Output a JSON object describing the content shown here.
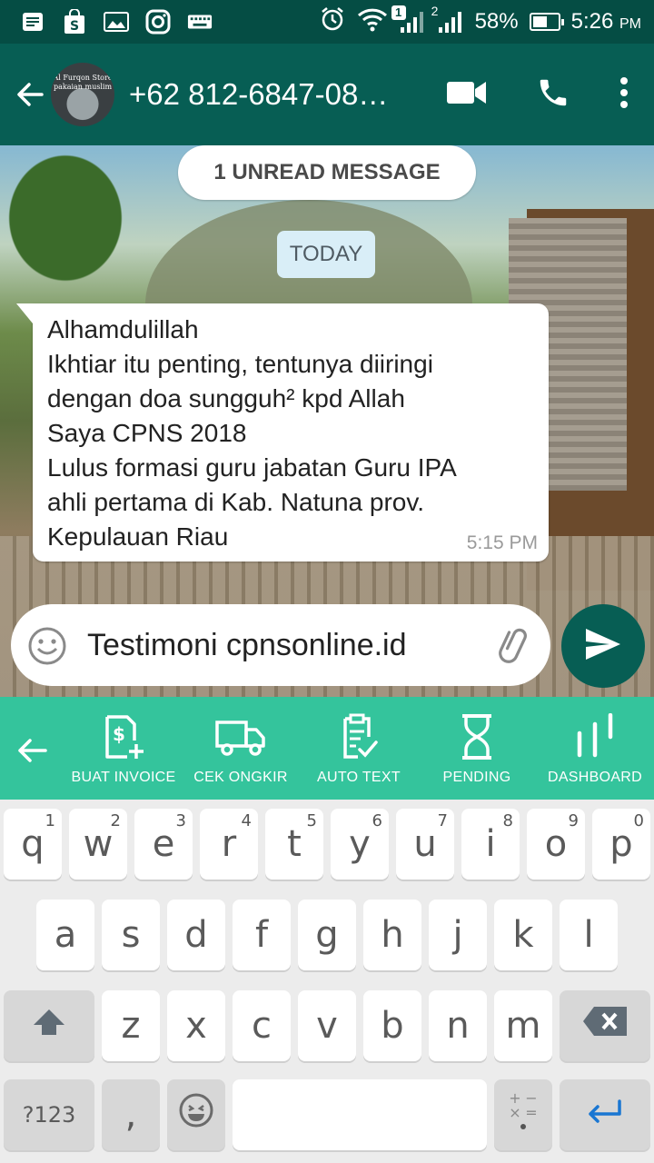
{
  "status_bar": {
    "notification_badge": "1",
    "signal_label": "2",
    "battery_percent": "58%",
    "battery_level": 0.58,
    "time": "5:26",
    "ampm": "PM"
  },
  "header": {
    "avatar_text_1": "Al Furqon Store",
    "avatar_text_2": "pakaian muslim",
    "contact": "+62 812-6847-08…"
  },
  "chat": {
    "unread_banner": "1 UNREAD MESSAGE",
    "date_chip": "TODAY",
    "message": {
      "lines": [
        "Alhamdulillah",
        "Ikhtiar itu penting, tentunya diiringi",
        "dengan doa sungguh² kpd Allah",
        "Saya CPNS 2018",
        "Lulus formasi guru jabatan Guru IPA",
        "ahli pertama di Kab. Natuna prov.",
        "Kepulauan Riau"
      ],
      "time": "5:15 PM"
    }
  },
  "composer": {
    "value": "Testimoni cpnsonline.id"
  },
  "toolbar": {
    "items": [
      {
        "label": "BUAT INVOICE",
        "icon": "invoice-icon"
      },
      {
        "label": "CEK ONGKIR",
        "icon": "truck-icon"
      },
      {
        "label": "AUTO TEXT",
        "icon": "clipboard-check-icon"
      },
      {
        "label": "PENDING",
        "icon": "hourglass-icon"
      },
      {
        "label": "DASHBOARD",
        "icon": "bar-chart-icon"
      }
    ]
  },
  "keyboard": {
    "row1": [
      {
        "k": "q",
        "h": "1"
      },
      {
        "k": "w",
        "h": "2"
      },
      {
        "k": "e",
        "h": "3"
      },
      {
        "k": "r",
        "h": "4"
      },
      {
        "k": "t",
        "h": "5"
      },
      {
        "k": "y",
        "h": "6"
      },
      {
        "k": "u",
        "h": "7"
      },
      {
        "k": "i",
        "h": "8"
      },
      {
        "k": "o",
        "h": "9"
      },
      {
        "k": "p",
        "h": "0"
      }
    ],
    "row2": [
      "a",
      "s",
      "d",
      "f",
      "g",
      "h",
      "j",
      "k",
      "l"
    ],
    "row3": [
      "z",
      "x",
      "c",
      "v",
      "b",
      "n",
      "m"
    ],
    "symbols_label": "?123",
    "comma": ","
  }
}
